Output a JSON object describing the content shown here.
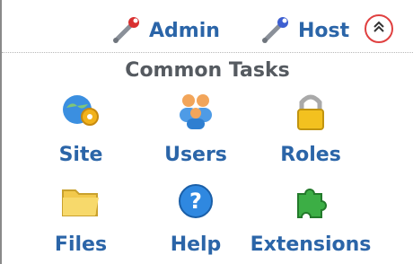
{
  "toolbar": {
    "admin_label": "Admin",
    "host_label": "Host",
    "collapse_icon": "chevron-double-up-icon"
  },
  "common_tasks": {
    "title": "Common Tasks",
    "items": [
      {
        "label": "Site",
        "icon": "globe-gear-icon"
      },
      {
        "label": "Users",
        "icon": "users-group-icon"
      },
      {
        "label": "Roles",
        "icon": "padlock-icon"
      },
      {
        "label": "Files",
        "icon": "folder-icon"
      },
      {
        "label": "Help",
        "icon": "help-question-icon"
      },
      {
        "label": "Extensions",
        "icon": "puzzle-piece-icon"
      }
    ]
  },
  "colors": {
    "link_blue": "#2b65a8",
    "heading_gray": "#555a60",
    "collapse_ring": "#e04040"
  }
}
